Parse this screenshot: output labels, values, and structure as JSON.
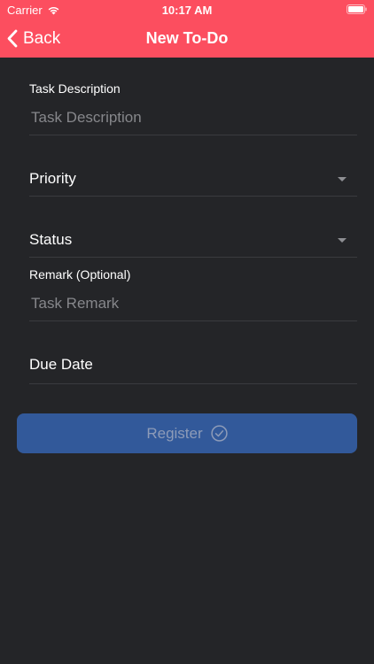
{
  "status_bar": {
    "carrier": "Carrier",
    "time": "10:17 AM"
  },
  "nav": {
    "back_label": "Back",
    "title": "New To-Do"
  },
  "form": {
    "task_description": {
      "label": "Task Description",
      "placeholder": "Task Description",
      "value": ""
    },
    "priority": {
      "label": "Priority"
    },
    "status": {
      "label": "Status"
    },
    "remark": {
      "label": "Remark (Optional)",
      "placeholder": "Task Remark",
      "value": ""
    },
    "due_date": {
      "label": "Due Date"
    },
    "register_label": "Register"
  },
  "icons": {
    "back": "chevron-left-icon",
    "wifi": "wifi-icon",
    "battery": "battery-icon",
    "dropdown": "caret-down-icon",
    "register": "check-circle-icon"
  },
  "colors": {
    "header_bg": "#fc4e5f",
    "page_bg": "#242528",
    "button_bg": "#32599a",
    "button_text": "#8d9bb8",
    "placeholder": "#86878b"
  }
}
